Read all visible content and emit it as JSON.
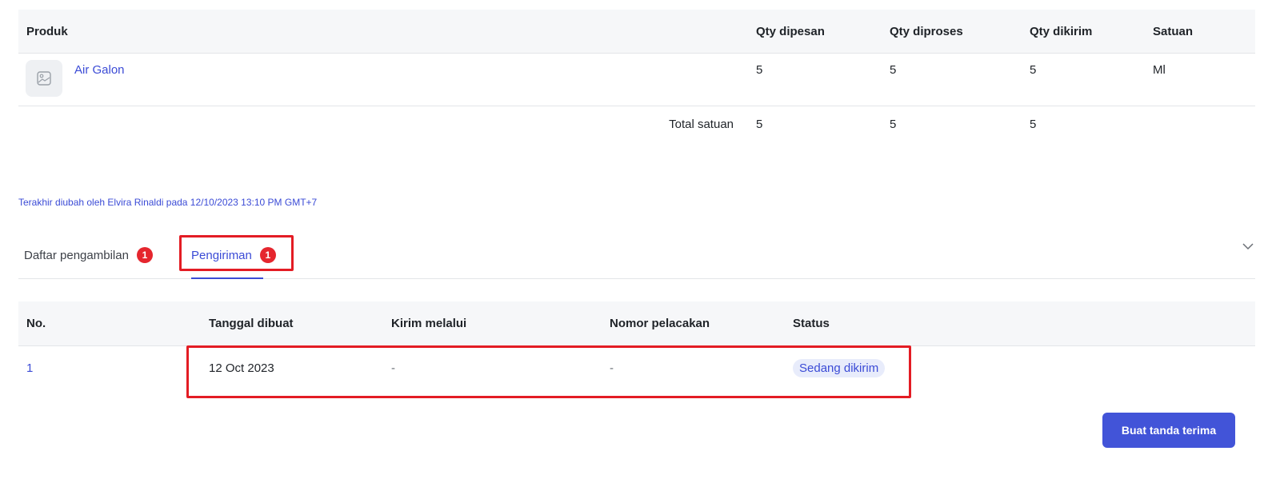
{
  "products_table": {
    "headers": {
      "product": "Produk",
      "qty_ordered": "Qty dipesan",
      "qty_processed": "Qty diproses",
      "qty_shipped": "Qty dikirim",
      "unit": "Satuan"
    },
    "rows": [
      {
        "icon": "image-placeholder-icon",
        "name": "Air Galon",
        "qty_ordered": "5",
        "qty_processed": "5",
        "qty_shipped": "5",
        "unit": "Ml"
      }
    ],
    "total": {
      "label": "Total satuan",
      "qty_ordered": "5",
      "qty_processed": "5",
      "qty_shipped": "5"
    }
  },
  "last_edited": "Terakhir diubah oleh Elvira Rinaldi pada 12/10/2023 13:10 PM GMT+7",
  "tabs": [
    {
      "label": "Daftar pengambilan",
      "badge": "1",
      "active": false
    },
    {
      "label": "Pengiriman",
      "badge": "1",
      "active": true
    }
  ],
  "collapse_icon": "chevron-down-icon",
  "shipments_table": {
    "headers": {
      "no": "No.",
      "created_date": "Tanggal dibuat",
      "ship_via": "Kirim melalui",
      "tracking_number": "Nomor pelacakan",
      "status": "Status"
    },
    "rows": [
      {
        "no": "1",
        "created_date": "12 Oct 2023",
        "ship_via": "-",
        "tracking_number": "-",
        "status": "Sedang dikirim"
      }
    ]
  },
  "actions": {
    "create_receipt": "Buat tanda terima"
  },
  "colors": {
    "accent": "#3b4bd6",
    "badge": "#e5262e",
    "highlight": "#e31c24",
    "button": "#4254d8"
  }
}
